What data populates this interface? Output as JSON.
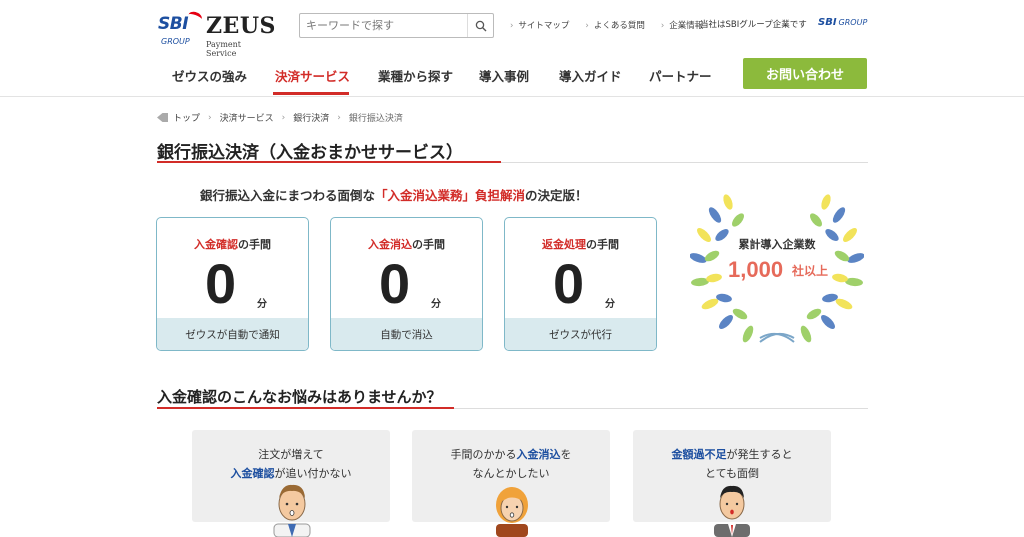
{
  "header": {
    "logo": {
      "sbi": "SBI",
      "group": "GROUP",
      "zeus": "ZEUS",
      "payment_service": "Payment Service"
    },
    "search": {
      "placeholder": "キーワードで探す"
    },
    "top_links": [
      "サイトマップ",
      "よくある質問",
      "企業情報"
    ],
    "corp_text": "当社はSBIグループ企業です",
    "corp_logo": {
      "sbi": "SBI",
      "group": "GROUP"
    },
    "nav": [
      "ゼウスの強み",
      "決済サービス",
      "業種から探す",
      "導入事例",
      "導入ガイド",
      "パートナー"
    ],
    "contact_label": "お問い合わせ"
  },
  "breadcrumb": [
    "トップ",
    "決済サービス",
    "銀行決済",
    "銀行振込決済"
  ],
  "page_title": "銀行振込決済（入金おまかせサービス）",
  "lead": {
    "pre": "銀行振込入金にまつわる面倒な",
    "highlight": "「入金消込業務」負担解消",
    "post": "の決定版！"
  },
  "cards": [
    {
      "title_red": "入金確認",
      "title_rest": "の手間",
      "value": "0",
      "unit": "分",
      "foot": "ゼウスが自動で通知"
    },
    {
      "title_red": "入金消込",
      "title_rest": "の手間",
      "value": "0",
      "unit": "分",
      "foot": "自動で消込"
    },
    {
      "title_red": "返金処理",
      "title_rest": "の手間",
      "value": "0",
      "unit": "分",
      "foot": "ゼウスが代行"
    }
  ],
  "badge": {
    "title": "累計導入企業数",
    "number": "1,000",
    "suffix": "社以上"
  },
  "section2_title": "入金確認のこんなお悩みはありませんか？",
  "worries": [
    {
      "line1": "注文が増えて",
      "line2_blue": "入金確認",
      "line2_rest": "が追い付かない"
    },
    {
      "line1_pre": "手間のかかる",
      "line1_blue": "入金消込",
      "line1_post": "を",
      "line2": "なんとかしたい"
    },
    {
      "line1_blue": "金額過不足",
      "line1_post": "が発生すると",
      "line2": "とても面倒"
    }
  ],
  "colors": {
    "accent_red": "#d22c28",
    "contact_green": "#8cba3c",
    "brand_blue": "#1d4fa0",
    "card_border": "#7fb8c8",
    "card_foot": "#d9eaee"
  }
}
